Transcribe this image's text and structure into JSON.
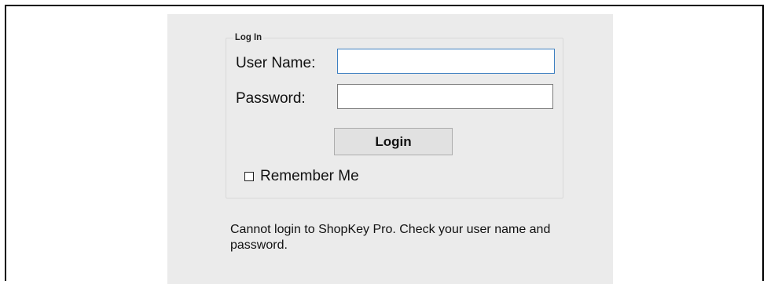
{
  "login_form": {
    "group_title": "Log In",
    "username_label": "User Name:",
    "username_value": "",
    "password_label": "Password:",
    "password_value": "",
    "login_button": "Login",
    "remember_me_label": "Remember Me",
    "remember_me_checked": false
  },
  "status": {
    "error_message": "Cannot login to ShopKey Pro. Check your user name and password."
  },
  "colors": {
    "panel_background": "#ebebeb",
    "focused_input_border": "#3d7fc1",
    "button_background": "#e1e1e1"
  }
}
